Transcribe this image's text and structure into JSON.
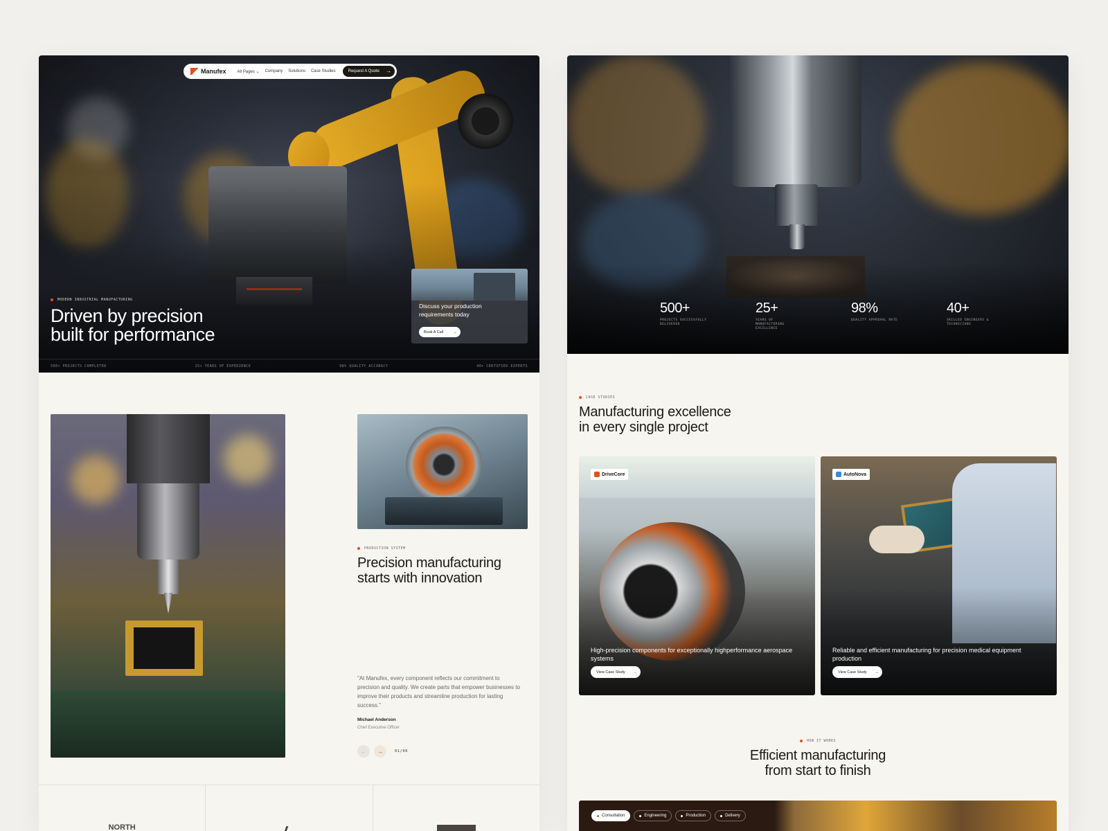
{
  "colors": {
    "accent": "#e2501c",
    "dark": "#1b1816",
    "background": "#f7f5f0",
    "robot_yellow": "#f0b62a"
  },
  "left": {
    "nav": {
      "brand": "Manufex",
      "links": [
        "All Pages",
        "Company",
        "Solutions",
        "Case Studies"
      ],
      "cta": "Request A Quote"
    },
    "hero": {
      "eyebrow": "Modern Industrial Manufacturing",
      "title_line1": "Driven by precision",
      "title_line2": "built for performance",
      "card_text": "Discuss your production requirements today",
      "card_button": "Book A Call",
      "stats": [
        "500+ Projects Completed",
        "25+ Years of Experience",
        "98% Quality Accuracy",
        "40+ Certified Experts"
      ]
    },
    "production": {
      "eyebrow": "Production System",
      "title_line1": "Precision manufacturing",
      "title_line2": "starts with innovation",
      "quote": "\"At Manufex, every component reflects our commitment to precision and quality. We create parts that empower businesses to improve their products and streamline production for lasting success.\"",
      "author": "Michael Anderson",
      "role": "Chief Executive Officer",
      "counter": "01/06"
    },
    "partners": [
      "NORTH",
      "",
      ""
    ]
  },
  "right": {
    "stats": [
      {
        "value": "500+",
        "label": "Projects Successfully Delivered"
      },
      {
        "value": "25+",
        "label": "Years of Manufacturing Excellence"
      },
      {
        "value": "98%",
        "label": "Quality Approval Rate"
      },
      {
        "value": "40+",
        "label": "Skilled Engineers & Technicians"
      }
    ],
    "cases": {
      "eyebrow": "Case Studies",
      "title_line1": "Manufacturing excellence",
      "title_line2": "in every single project",
      "items": [
        {
          "brand": "DriveCore",
          "text": "High-precision components for exceptionally highperformance aerospace systems",
          "button": "View Case Study"
        },
        {
          "brand": "AutoNova",
          "text": "Reliable and efficient manufacturing for precision medical equipment production",
          "button": "View Case Study"
        }
      ]
    },
    "process": {
      "eyebrow": "How It Works",
      "title_line1": "Efficient manufacturing",
      "title_line2": "from start to finish",
      "steps": [
        "Consultation",
        "Engineering",
        "Production",
        "Delivery"
      ]
    }
  }
}
